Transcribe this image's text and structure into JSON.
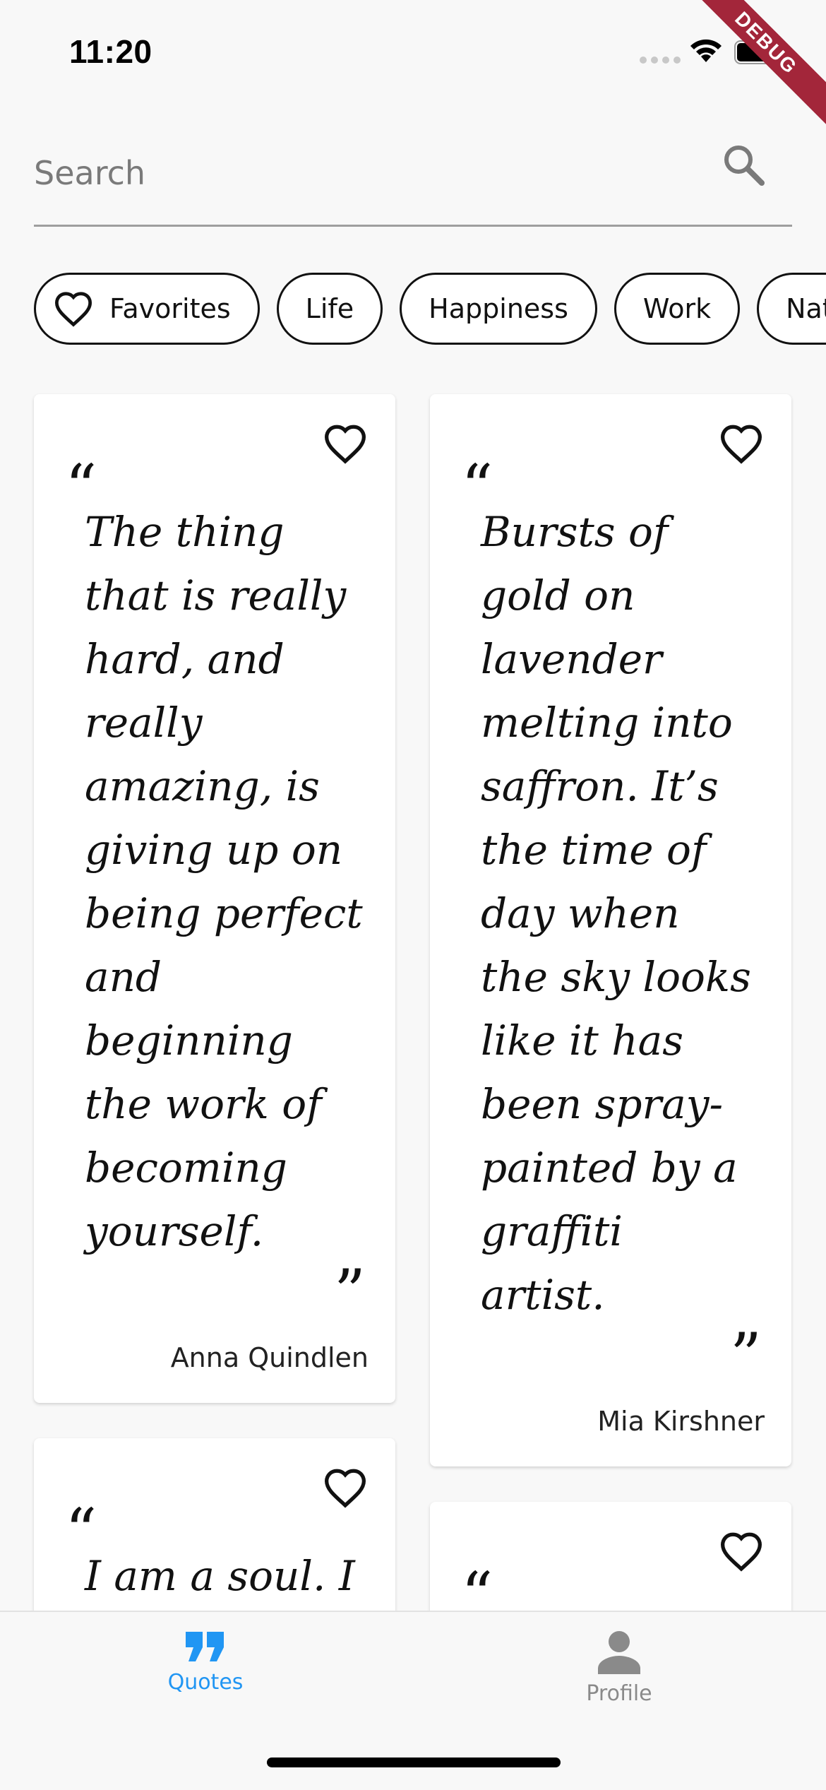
{
  "status_bar": {
    "time": "11:20",
    "debug_banner": "DEBUG"
  },
  "search": {
    "placeholder": "Search",
    "value": ""
  },
  "chips": [
    {
      "label": "Favorites",
      "icon": "heart-outline-icon"
    },
    {
      "label": "Life"
    },
    {
      "label": "Happiness"
    },
    {
      "label": "Work"
    },
    {
      "label": "Nature"
    }
  ],
  "quotes": [
    {
      "text": "The thing\nthat is really\nhard, and\nreally\namazing, is\ngiving up on\nbeing perfect\nand\nbeginning\nthe work of\nbecoming\nyourself.",
      "author": "Anna Quindlen",
      "favorite": false
    },
    {
      "text": "Bursts of\ngold on\nlavender\nmelting into\nsaffron. It’s\nthe time of\nday when\nthe sky looks\nlike it has\nbeen spray-\npainted by a\ngraffiti\nartist.",
      "author": "Mia Kirshner",
      "favorite": false
    },
    {
      "text": "I am a soul. I",
      "author": "",
      "favorite": false
    },
    {
      "text": "",
      "author": "",
      "favorite": false
    }
  ],
  "glyphs": {
    "open_quote": "”",
    "close_quote": "”"
  },
  "bottom_nav": [
    {
      "label": "Quotes",
      "icon": "quote-icon",
      "active": true
    },
    {
      "label": "Profile",
      "icon": "person-icon",
      "active": false
    }
  ],
  "colors": {
    "accent": "#2196f3",
    "inactive": "#8a8a8a",
    "background": "#f8f8f8",
    "card": "#ffffff",
    "debug_ribbon": "#a3263a"
  }
}
